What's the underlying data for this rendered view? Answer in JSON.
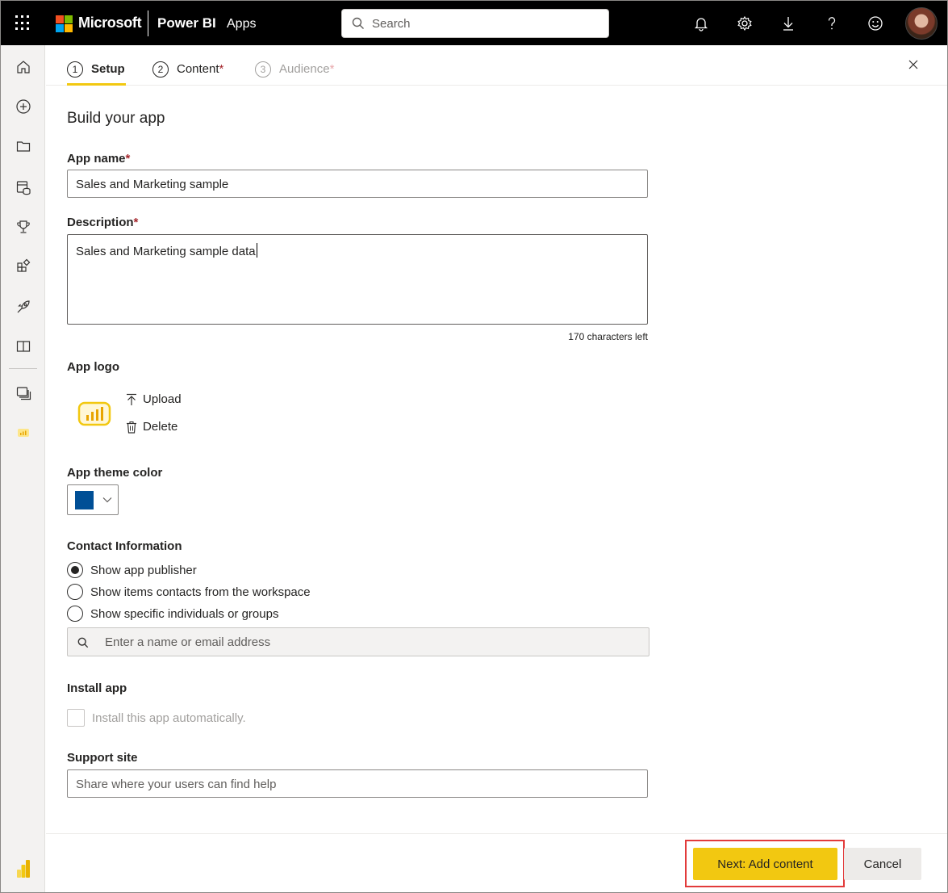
{
  "header": {
    "company": "Microsoft",
    "product": "Power BI",
    "section": "Apps",
    "search_placeholder": "Search",
    "brand_colors": {
      "red": "#f25022",
      "green": "#7fba00",
      "blue": "#00a4ef",
      "yellow": "#ffb900"
    },
    "icons": [
      "app-launcher-icon",
      "notifications-icon",
      "settings-icon",
      "download-icon",
      "help-icon",
      "feedback-icon",
      "profile-avatar"
    ]
  },
  "leftnav": {
    "items": [
      "home-icon",
      "create-icon",
      "browse-icon",
      "data-hub-icon",
      "metrics-icon",
      "apps-icon",
      "deployment-pipelines-icon",
      "learn-icon",
      "workspaces-icon",
      "workspace-app-icon"
    ],
    "bottom_icon": "power-bi-logo-icon"
  },
  "tabs": [
    {
      "number": "1",
      "label": "Setup",
      "required": "",
      "state": "active"
    },
    {
      "number": "2",
      "label": "Content",
      "required": "*",
      "state": "normal"
    },
    {
      "number": "3",
      "label": "Audience",
      "required": "*",
      "state": "disabled"
    }
  ],
  "form": {
    "heading": "Build your app",
    "app_name": {
      "label": "App name",
      "required": "*",
      "value": "Sales and Marketing sample"
    },
    "description": {
      "label": "Description",
      "required": "*",
      "value": "Sales and Marketing sample data",
      "chars_left": "170 characters left"
    },
    "app_logo": {
      "label": "App logo",
      "upload": "Upload",
      "delete": "Delete"
    },
    "theme_color": {
      "label": "App theme color",
      "value": "#004f96"
    },
    "contact": {
      "label": "Contact Information",
      "options": [
        {
          "label": "Show app publisher",
          "checked": true
        },
        {
          "label": "Show items contacts from the workspace",
          "checked": false
        },
        {
          "label": "Show specific individuals or groups",
          "checked": false
        }
      ],
      "people_placeholder": "Enter a name or email address"
    },
    "install": {
      "label": "Install app",
      "checkbox_label": "Install this app automatically.",
      "checked": false,
      "disabled": true
    },
    "support": {
      "label": "Support site",
      "placeholder": "Share where your users can find help"
    }
  },
  "footer": {
    "next_label": "Next: Add content",
    "cancel_label": "Cancel",
    "accent_color": "#f2c811",
    "highlight_color": "#e23b3b"
  }
}
